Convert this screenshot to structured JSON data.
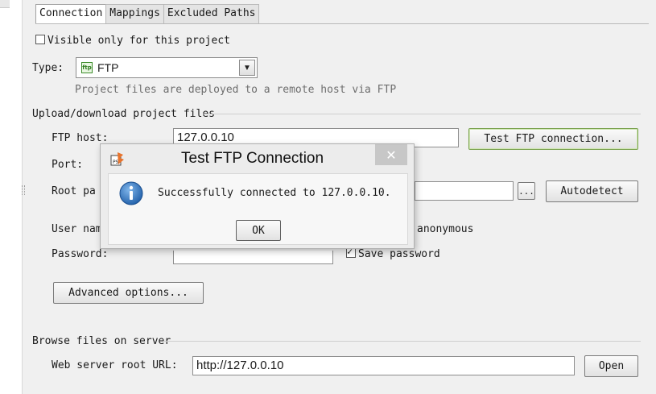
{
  "tabs": [
    {
      "label": "Connection",
      "active": true
    },
    {
      "label": "Mappings",
      "active": false
    },
    {
      "label": "Excluded Paths",
      "active": false
    }
  ],
  "visible_only": {
    "label": "Visible only for this project",
    "checked": false
  },
  "type": {
    "label": "Type:",
    "value": "FTP",
    "icon_text": "ftp",
    "description": "Project files are deployed to a remote host via FTP"
  },
  "upload_section": {
    "title": "Upload/download project files",
    "ftp_host_label": "FTP host:",
    "ftp_host_value": "127.0.0.10",
    "test_button": "Test FTP connection...",
    "port_label": "Port:",
    "root_path_label": "Root pa",
    "browse_button": "...",
    "autodetect_button": "Autodetect",
    "user_name_label": "User nam",
    "anonymous_label": "anonymous",
    "password_label": "Password:",
    "save_password_label": "Save password",
    "save_password_checked": true,
    "advanced_button": "Advanced options..."
  },
  "browse_section": {
    "title": "Browse files on server",
    "web_root_label": "Web server root URL:",
    "web_root_value": "http://127.0.0.10",
    "open_button": "Open"
  },
  "dialog": {
    "title": "Test FTP Connection",
    "message": "Successfully connected to 127.0.0.10.",
    "ok_button": "OK",
    "close_symbol": "✕"
  },
  "colors": {
    "accent_blue": "#2f6fb7",
    "ok_border_green": "#7aa24e"
  }
}
